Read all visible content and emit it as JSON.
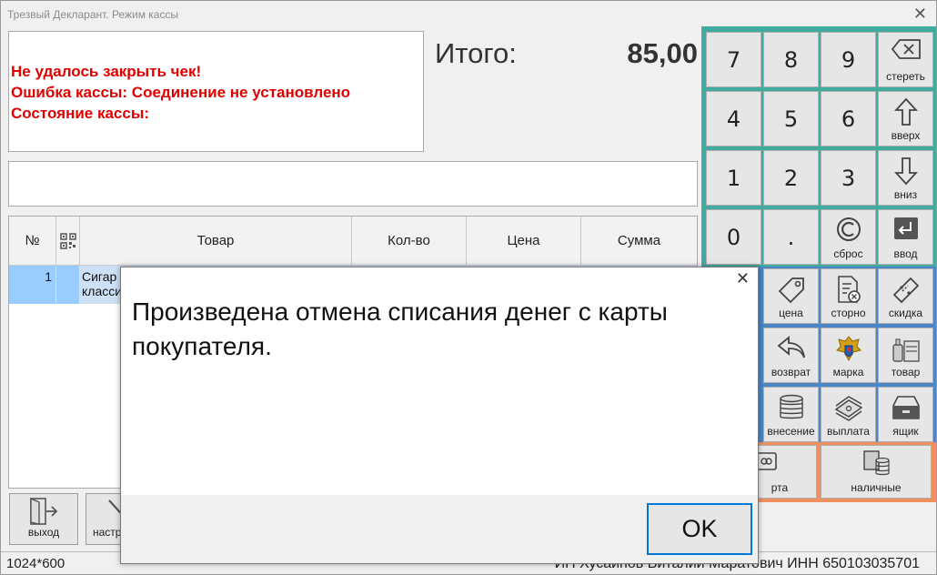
{
  "window": {
    "title": "Трезвый Декларант. Режим кассы",
    "close_glyph": "✕"
  },
  "message": {
    "lines": [
      "Не удалось закрыть чек!",
      "Ошибка кассы: Соединение не установлено",
      "Состояние кассы:"
    ],
    "color": "#e00000"
  },
  "total": {
    "label": "Итого:",
    "value": "85,00"
  },
  "table": {
    "headers": {
      "num": "№",
      "qr_icon": "qr-icon",
      "product": "Товар",
      "qty": "Кол-во",
      "price": "Цена",
      "sum": "Сумма"
    },
    "rows": [
      {
        "num": "1",
        "product": "Сигар\nкласси"
      }
    ]
  },
  "bottom_buttons": [
    {
      "label": "выход",
      "icon": "exit-icon"
    },
    {
      "label": "настр",
      "icon": "settings-icon"
    }
  ],
  "status": {
    "resolution": "1024*600",
    "owner": "ИП Хусаинов Виталий Маратович ИНН 650103035701"
  },
  "keypad": {
    "digits": [
      "7",
      "8",
      "9",
      "4",
      "5",
      "6",
      "1",
      "2",
      "3",
      "0",
      "."
    ],
    "erase": "стереть",
    "up": "вверх",
    "down": "вниз",
    "reset": "сброс",
    "enter": "ввод",
    "price": "цена",
    "storno": "сторно",
    "discount": "скидка",
    "return": "возврат",
    "mark": "марка",
    "goods": "товар",
    "cash_in": "внесение",
    "cash_out": "выплата",
    "drawer": "ящик",
    "card": "рта",
    "cash": "наличные"
  },
  "colors": {
    "teal": "#42aba0",
    "blue": "#4c86c6",
    "orange": "#f09060",
    "focus": "#0078d7",
    "selection": "#99ccff"
  },
  "dialog": {
    "message": "Произведена отмена списания денег с карты покупателя.",
    "ok_label": "OK",
    "close_glyph": "✕"
  }
}
